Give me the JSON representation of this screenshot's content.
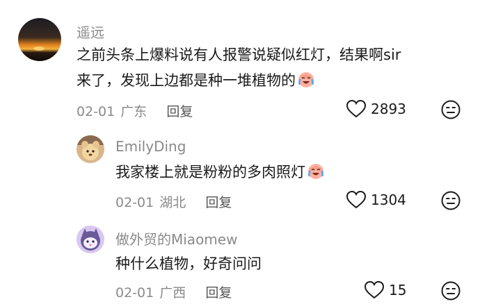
{
  "comments": [
    {
      "username": "遥远",
      "text_line1": "之前头条上爆料说有人报警说疑似红灯，结果啊sir",
      "text_line2": "来了，发现上边都是种一堆植物的",
      "date": "02-01",
      "location": "广东",
      "reply_label": "回复",
      "likes": "2893"
    },
    {
      "username": "EmilyDing",
      "text_line1": "我家楼上就是粉粉的多肉照灯",
      "date": "02-01",
      "location": "湖北",
      "reply_label": "回复",
      "likes": "1304"
    },
    {
      "username": "做外贸的Miaomew",
      "text_line1": "种什么植物，好奇问问",
      "date": "02-01",
      "location": "广西",
      "reply_label": "回复",
      "likes": "15"
    }
  ],
  "icons": {
    "like": "heart-outline-icon",
    "more": "neutral-face-icon",
    "emoji": "laughing-crying-face-emoji"
  }
}
